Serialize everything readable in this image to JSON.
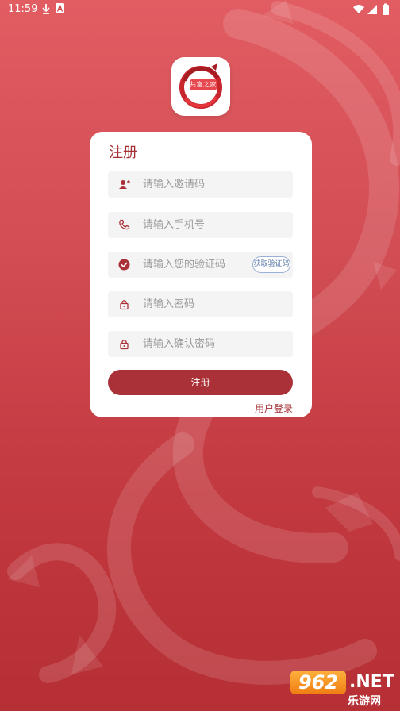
{
  "status_bar": {
    "time": "11:59"
  },
  "logo": {
    "text": "共富之家"
  },
  "form": {
    "title": "注册",
    "invite_placeholder": "请输入邀请码",
    "phone_placeholder": "请输入手机号",
    "code_placeholder": "请输入您的验证码",
    "get_code_label": "获取验证码",
    "password_placeholder": "请输入密码",
    "confirm_placeholder": "请输入确认密码",
    "submit_label": "注册",
    "login_link": "用户登录"
  },
  "watermark": {
    "badge": "962",
    "suffix": ".NET",
    "sub": "乐游网"
  },
  "icons": {
    "invite": "user-plus-icon",
    "phone": "phone-icon",
    "code": "check-circle-icon",
    "password": "lock-icon",
    "confirm": "lock-icon"
  },
  "colors": {
    "background_top": "#e15d62",
    "background_bottom": "#b52f35",
    "accent": "#a93137",
    "field_bg": "#f4f4f4"
  }
}
